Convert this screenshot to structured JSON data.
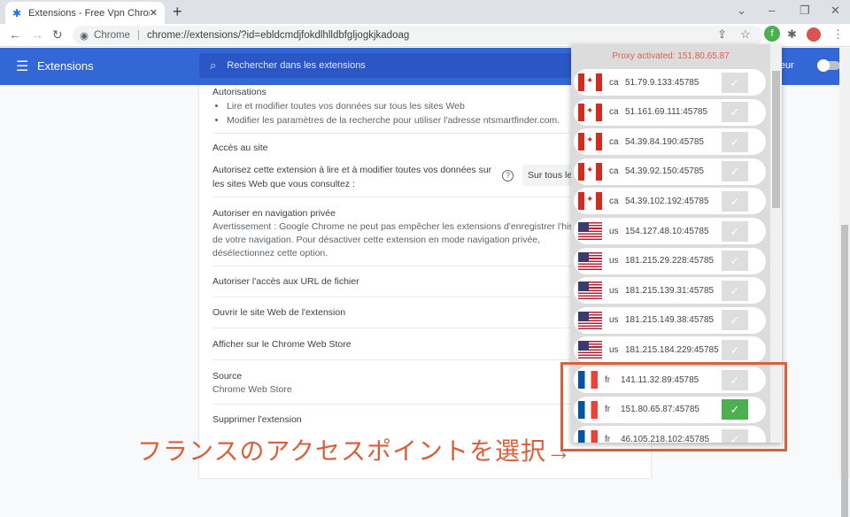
{
  "browser": {
    "tab_title": "Extensions - Free Vpn Chrome - Free",
    "omnibox_label": "Chrome",
    "url": "chrome://extensions/?id=ebldcmdjfokdlhlldbfgljogkjkadoag"
  },
  "header": {
    "title": "Extensions",
    "search_placeholder": "Rechercher dans les extensions",
    "dev_mode": "loppeur"
  },
  "details": {
    "permissions_title": "Autorisations",
    "permissions": [
      "Lire et modifier toutes vos données sur tous les sites Web",
      "Modifier les paramètres de la recherche pour utiliser l'adresse ntsmartfinder.com."
    ],
    "site_access_title": "Accès au site",
    "site_access_text": "Autorisez cette extension à lire et à modifier toutes vos données sur les sites Web que vous consultez :",
    "site_access_value": "Sur tous les sites",
    "incognito_title": "Autoriser en navigation privée",
    "incognito_text": "Avertissement : Google Chrome ne peut pas empêcher les extensions d'enregistrer l'historique de votre navigation. Pour désactiver cette extension en mode navigation privée, désélectionnez cette option.",
    "file_urls": "Autoriser l'accès aux URL de fichier",
    "open_site": "Ouvrir le site Web de l'extension",
    "webstore": "Afficher sur le Chrome Web Store",
    "source_title": "Source",
    "source_value": "Chrome Web Store",
    "remove": "Supprimer l'extension"
  },
  "popup": {
    "status": "Proxy activated: 151.80.65.87",
    "proxies": [
      {
        "cc": "ca",
        "ip": "51.79.9.133:45785",
        "active": false
      },
      {
        "cc": "ca",
        "ip": "51.161.69.111:45785",
        "active": false
      },
      {
        "cc": "ca",
        "ip": "54.39.84.190:45785",
        "active": false
      },
      {
        "cc": "ca",
        "ip": "54.39.92.150:45785",
        "active": false
      },
      {
        "cc": "ca",
        "ip": "54.39.102.192:45785",
        "active": false
      },
      {
        "cc": "us",
        "ip": "154.127.48.10:45785",
        "active": false
      },
      {
        "cc": "us",
        "ip": "181.215.29.228:45785",
        "active": false
      },
      {
        "cc": "us",
        "ip": "181.215.139.31:45785",
        "active": false
      },
      {
        "cc": "us",
        "ip": "181.215.149.38:45785",
        "active": false
      },
      {
        "cc": "us",
        "ip": "181.215.184.229:45785",
        "active": false
      },
      {
        "cc": "fr",
        "ip": "141.11.32.89:45785",
        "active": false
      },
      {
        "cc": "fr",
        "ip": "151.80.65.87:45785",
        "active": true
      },
      {
        "cc": "fr",
        "ip": "46.105.218.102:45785",
        "active": false
      }
    ]
  },
  "annotation": {
    "caption": "フランスのアクセスポイントを選択→",
    "color": "#d9603b"
  }
}
